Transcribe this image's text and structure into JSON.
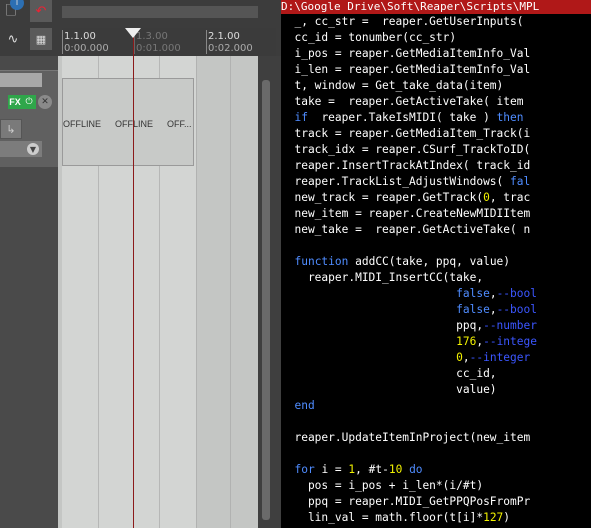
{
  "colors": {
    "code_bg": "#000000",
    "code_text": "#ffffff",
    "keyword": "#4f8cff",
    "number": "#f2f200",
    "comment": "#3b56ff",
    "title_bar": "#b01818",
    "fx_green": "#2fa64a",
    "cursor_red": "#8b1a1a"
  },
  "daw": {
    "ruler": {
      "marks": [
        {
          "top": "1.1.00",
          "sub": "0:00.000"
        },
        {
          "top": "1.3.00",
          "sub": "0:01.000"
        },
        {
          "top": "2.1.00",
          "sub": "0:02.000"
        }
      ]
    },
    "track": {
      "fx_label": "FX",
      "power_icon": "power-icon",
      "remove_icon": "x-icon",
      "chevron_icon": "chevron-down-icon"
    },
    "media_item": {
      "labels": [
        "OFFLINE",
        "OFFLINE",
        "OFF..."
      ]
    },
    "toolbar_icons": [
      "document-icon",
      "info-badge-icon",
      "undo-arrow-icon",
      "envelope-curve-icon",
      "grid-icon"
    ]
  },
  "code": {
    "title": "D:\\Google Drive\\Soft\\Reaper\\Scripts\\MPL",
    "lines": [
      [
        {
          "t": "  _, cc_str =  reaper.GetUserInputs(",
          "c": "p"
        }
      ],
      [
        {
          "t": "  cc_id = tonumber(cc_str)",
          "c": "p"
        }
      ],
      [
        {
          "t": "  i_pos = reaper.GetMediaItemInfo_Val",
          "c": "p"
        }
      ],
      [
        {
          "t": "  i_len = reaper.GetMediaItemInfo_Val",
          "c": "p"
        }
      ],
      [
        {
          "t": "  t, window = Get_take_data(item)",
          "c": "p"
        }
      ],
      [
        {
          "t": "  take =  reaper.GetActiveTake( item",
          "c": "p"
        }
      ],
      [
        {
          "t": "  ",
          "c": "p"
        },
        {
          "t": "if",
          "c": "kw"
        },
        {
          "t": "  reaper.TakeIsMIDI( take ) ",
          "c": "p"
        },
        {
          "t": "then",
          "c": "kw"
        }
      ],
      [
        {
          "t": "  track = reaper.GetMediaItem_Track(i",
          "c": "p"
        }
      ],
      [
        {
          "t": "  track_idx = reaper.CSurf_TrackToID(",
          "c": "p"
        }
      ],
      [
        {
          "t": "  reaper.InsertTrackAtIndex( track_id",
          "c": "p"
        }
      ],
      [
        {
          "t": "  reaper.TrackList_AdjustWindows( ",
          "c": "p"
        },
        {
          "t": "fal",
          "c": "kw"
        }
      ],
      [
        {
          "t": "  new_track = reaper.GetTrack(",
          "c": "p"
        },
        {
          "t": "0",
          "c": "num"
        },
        {
          "t": ", trac",
          "c": "p"
        }
      ],
      [
        {
          "t": "  new_item = reaper.CreateNewMIDIItem",
          "c": "p"
        }
      ],
      [
        {
          "t": "  new_take =  reaper.GetActiveTake( n",
          "c": "p"
        }
      ],
      [
        {
          "t": "",
          "c": "p"
        }
      ],
      [
        {
          "t": "  ",
          "c": "p"
        },
        {
          "t": "function",
          "c": "kw"
        },
        {
          "t": " addCC(take, ppq, value)",
          "c": "p"
        }
      ],
      [
        {
          "t": "    reaper.MIDI_InsertCC(take,",
          "c": "p"
        }
      ],
      [
        {
          "t": "                          ",
          "c": "p"
        },
        {
          "t": "false",
          "c": "kw"
        },
        {
          "t": ",",
          "c": "p"
        },
        {
          "t": "--bool",
          "c": "cm"
        }
      ],
      [
        {
          "t": "                          ",
          "c": "p"
        },
        {
          "t": "false",
          "c": "kw"
        },
        {
          "t": ",",
          "c": "p"
        },
        {
          "t": "--bool",
          "c": "cm"
        }
      ],
      [
        {
          "t": "                          ppq,",
          "c": "p"
        },
        {
          "t": "--number",
          "c": "cm"
        }
      ],
      [
        {
          "t": "                          ",
          "c": "p"
        },
        {
          "t": "176",
          "c": "num"
        },
        {
          "t": ",",
          "c": "p"
        },
        {
          "t": "--intege",
          "c": "cm"
        }
      ],
      [
        {
          "t": "                          ",
          "c": "p"
        },
        {
          "t": "0",
          "c": "num"
        },
        {
          "t": ",",
          "c": "p"
        },
        {
          "t": "--integer",
          "c": "cm"
        }
      ],
      [
        {
          "t": "                          cc_id,",
          "c": "p"
        }
      ],
      [
        {
          "t": "                          value)",
          "c": "p"
        }
      ],
      [
        {
          "t": "  ",
          "c": "p"
        },
        {
          "t": "end",
          "c": "kw"
        }
      ],
      [
        {
          "t": "",
          "c": "p"
        }
      ],
      [
        {
          "t": "  reaper.UpdateItemInProject(new_item",
          "c": "p"
        }
      ],
      [
        {
          "t": "",
          "c": "p"
        }
      ],
      [
        {
          "t": "  ",
          "c": "p"
        },
        {
          "t": "for",
          "c": "kw"
        },
        {
          "t": " i = ",
          "c": "p"
        },
        {
          "t": "1",
          "c": "num"
        },
        {
          "t": ", #t-",
          "c": "p"
        },
        {
          "t": "10",
          "c": "num"
        },
        {
          "t": " ",
          "c": "p"
        },
        {
          "t": "do",
          "c": "kw"
        }
      ],
      [
        {
          "t": "    pos = i_pos + i_len*(i/#t)",
          "c": "p"
        }
      ],
      [
        {
          "t": "    ppq = reaper.MIDI_GetPPQPosFromPr",
          "c": "p"
        }
      ],
      [
        {
          "t": "    lin_val = math.floor(t[i]*",
          "c": "p"
        },
        {
          "t": "127",
          "c": "num"
        },
        {
          "t": ")",
          "c": "p"
        }
      ]
    ]
  }
}
